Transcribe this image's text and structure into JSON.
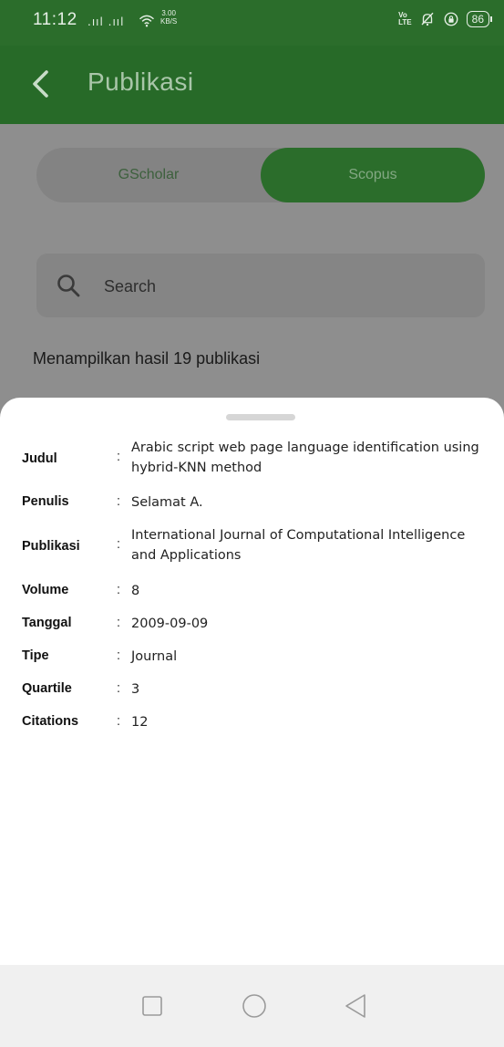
{
  "status_bar": {
    "time": "11:12",
    "signal": ".ııl .ııl",
    "net_speed_value": "3.00",
    "net_speed_unit": "KB/S",
    "volte_top": "Vo",
    "volte_bottom": "LTE",
    "battery": "86"
  },
  "app_bar": {
    "title": "Publikasi"
  },
  "tabs": [
    {
      "label": "GScholar",
      "selected": false
    },
    {
      "label": "Scopus",
      "selected": true
    }
  ],
  "search": {
    "placeholder": "Search"
  },
  "result_count": "Menampilkan hasil 19 publikasi",
  "detail": {
    "judul_label": "Judul",
    "judul_value": "Arabic script web page language identification using hybrid-KNN method",
    "penulis_label": "Penulis",
    "penulis_value": "Selamat A.",
    "publikasi_label": "Publikasi",
    "publikasi_value": "International Journal of Computational Intelligence and Applications",
    "volume_label": "Volume",
    "volume_value": "8",
    "tanggal_label": "Tanggal",
    "tanggal_value": "2009-09-09",
    "tipe_label": "Tipe",
    "tipe_value": "Journal",
    "quartile_label": "Quartile",
    "quartile_value": "3",
    "citations_label": "Citations",
    "citations_value": "12",
    "separator": ":"
  },
  "colors": {
    "primary_green": "#2b6d2b",
    "scrim_gray": "#8e8e8e",
    "sheet_bg": "#ffffff"
  }
}
